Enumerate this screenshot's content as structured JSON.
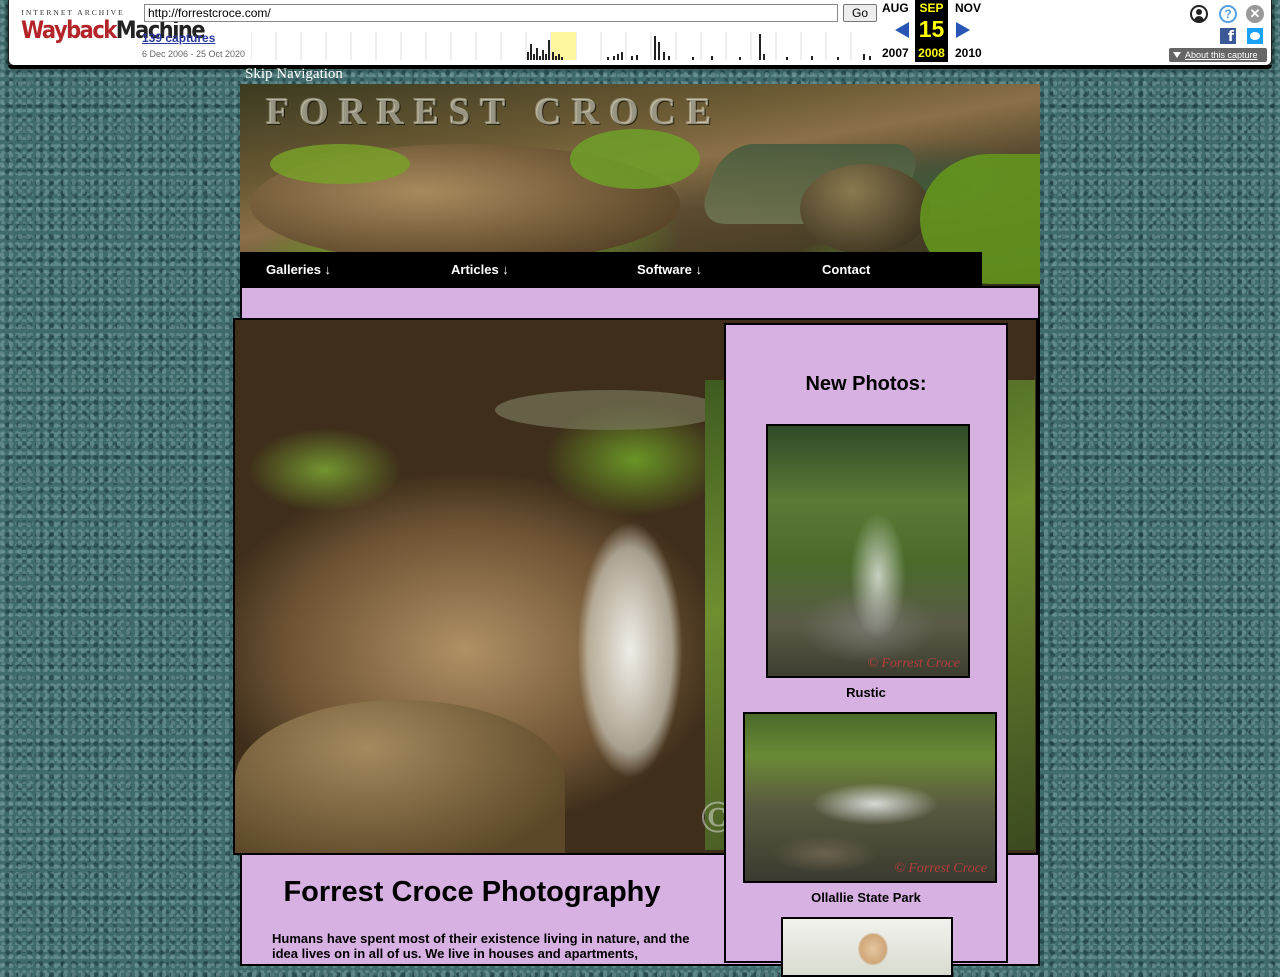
{
  "wayback": {
    "logo_top": "INTERNET ARCHIVE",
    "logo_wayback": "Wayback",
    "logo_machine": "Machine",
    "url": "http://forrestcroce.com/",
    "go_label": "Go",
    "captures_label": "139 captures",
    "date_range": "6 Dec 2006 - 25 Oct 2020",
    "prev_month": "AUG",
    "prev_year": "2007",
    "current_month": "SEP",
    "current_day": "15",
    "current_year": "2008",
    "next_month": "NOV",
    "next_year": "2010",
    "about_label": "About this capture",
    "facebook_glyph": "f",
    "help_glyph": "?",
    "close_glyph": "✕",
    "colors": {
      "accent": "#2956b5",
      "highlight": "#ffff00",
      "logo_red": "#b32529"
    }
  },
  "site": {
    "skip_nav": "Skip Navigation",
    "title": "FORREST CROCE",
    "nav": [
      {
        "label": "Galleries ↓"
      },
      {
        "label": "Articles ↓"
      },
      {
        "label": "Software ↓"
      },
      {
        "label": "Contact"
      }
    ],
    "page_heading": "Forrest Croce Photography",
    "intro": "Humans have spent most of their existence living in nature, and the idea lives on in all of us. We live in houses and apartments,",
    "hero_mark": "©",
    "colors": {
      "panel": "#d7b1e2",
      "nav_bg": "#000000",
      "page_bg": "#3f6b6c"
    }
  },
  "sidebar": {
    "heading": "New Photos:",
    "photos": [
      {
        "caption": "Rustic",
        "watermark": "© Forrest Croce"
      },
      {
        "caption": "Ollallie State Park",
        "watermark": "© Forrest Croce"
      }
    ]
  }
}
